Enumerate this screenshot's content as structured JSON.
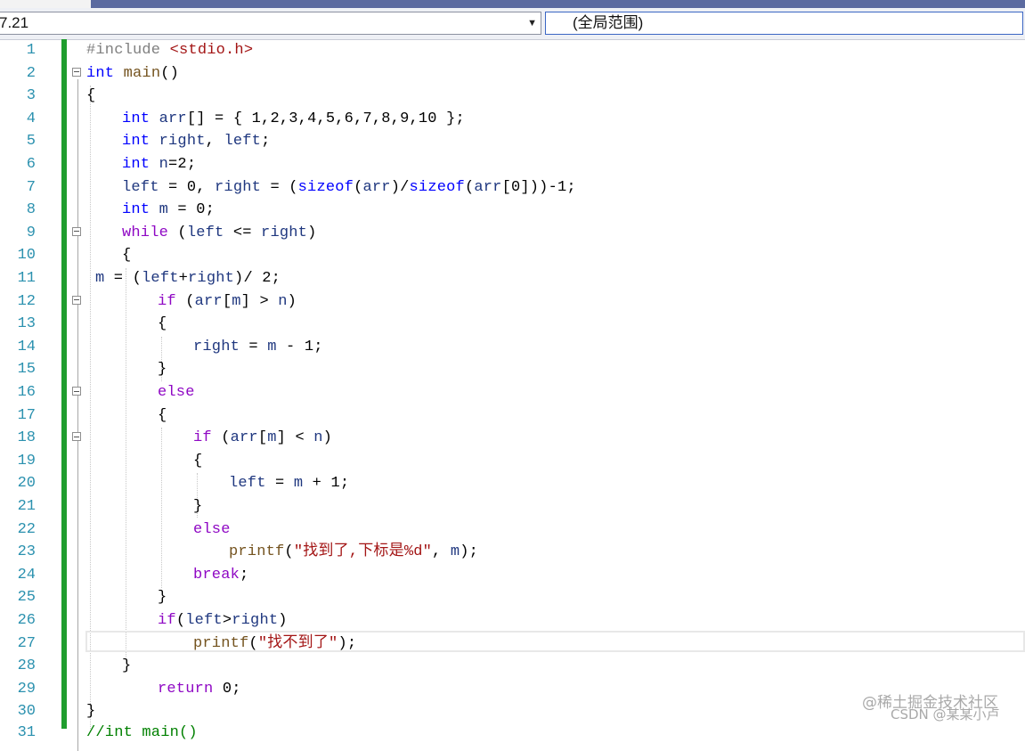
{
  "nav": {
    "left_combo": "7.21",
    "right_combo": "(全局范围)"
  },
  "lines": [
    {
      "n": "1",
      "t": "#include <stdio.h>"
    },
    {
      "n": "2",
      "t": "int main()"
    },
    {
      "n": "3",
      "t": "{"
    },
    {
      "n": "4",
      "t": "int arr[] = { 1,2,3,4,5,6,7,8,9,10 };"
    },
    {
      "n": "5",
      "t": "int right, left;"
    },
    {
      "n": "6",
      "t": "int n=2;"
    },
    {
      "n": "7",
      "t": "left = 0, right = (sizeof(arr)/sizeof(arr[0]))-1;"
    },
    {
      "n": "8",
      "t": "int m = 0;"
    },
    {
      "n": "9",
      "t": "while (left <= right)"
    },
    {
      "n": "10",
      "t": "{"
    },
    {
      "n": "11",
      "t": "m = (left+right)/ 2;"
    },
    {
      "n": "12",
      "t": "if (arr[m] > n)"
    },
    {
      "n": "13",
      "t": "{"
    },
    {
      "n": "14",
      "t": "right = m - 1;"
    },
    {
      "n": "15",
      "t": "}"
    },
    {
      "n": "16",
      "t": "else"
    },
    {
      "n": "17",
      "t": "{"
    },
    {
      "n": "18",
      "t": "if (arr[m] < n)"
    },
    {
      "n": "19",
      "t": "{"
    },
    {
      "n": "20",
      "t": "left = m + 1;"
    },
    {
      "n": "21",
      "t": "}"
    },
    {
      "n": "22",
      "t": "else"
    },
    {
      "n": "23",
      "t": "printf(\"找到了,下标是%d\", m);"
    },
    {
      "n": "24",
      "t": "break;"
    },
    {
      "n": "25",
      "t": "}"
    },
    {
      "n": "26",
      "t": "if(left>right)"
    },
    {
      "n": "27",
      "t": "printf(\"找不到了\");"
    },
    {
      "n": "28",
      "t": "}"
    },
    {
      "n": "29",
      "t": "return 0;"
    },
    {
      "n": "30",
      "t": "}"
    },
    {
      "n": "31",
      "t": "//int main()"
    }
  ],
  "watermark": {
    "line1": "@稀土掘金技术社区",
    "line2": "CSDN @某某小卢"
  },
  "colors": {
    "keyword": "#0000ff",
    "control": "#8f08c4",
    "preprocessor": "#808080",
    "string": "#a31515",
    "line_number": "#2b91af",
    "change_bar": "#1f9d2e"
  }
}
